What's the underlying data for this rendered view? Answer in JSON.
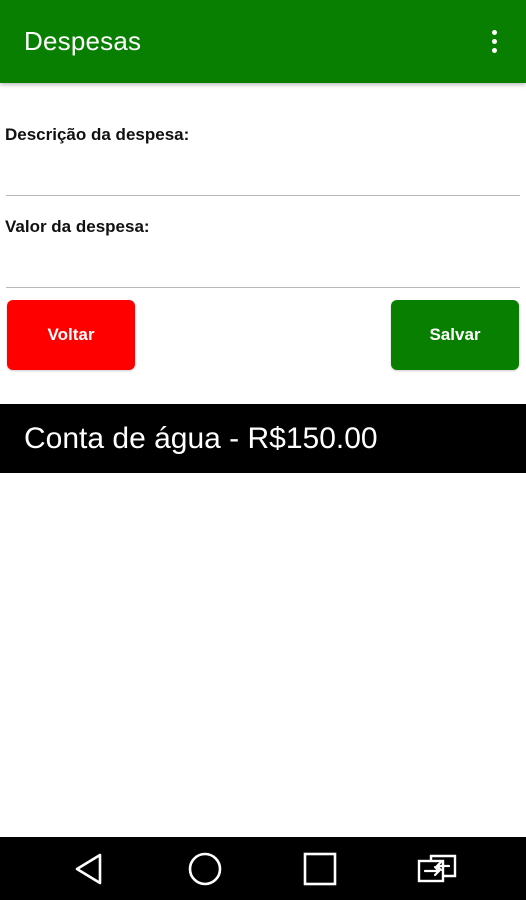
{
  "app_bar": {
    "title": "Despesas",
    "background": "#087f00",
    "overflow_icon": "more-vert-icon"
  },
  "form": {
    "description_label": "Descrição da despesa:",
    "description_value": "",
    "value_label": "Valor da despesa:",
    "value_value": ""
  },
  "buttons": {
    "back_label": "Voltar",
    "back_color": "#ff0000",
    "save_label": "Salvar",
    "save_color": "#087f00"
  },
  "expenses": [
    {
      "text": "Conta de água - R$150.00"
    }
  ],
  "nav_bar": {
    "icons": [
      "back-triangle-icon",
      "home-circle-icon",
      "recents-square-icon",
      "screen-switch-icon"
    ]
  }
}
